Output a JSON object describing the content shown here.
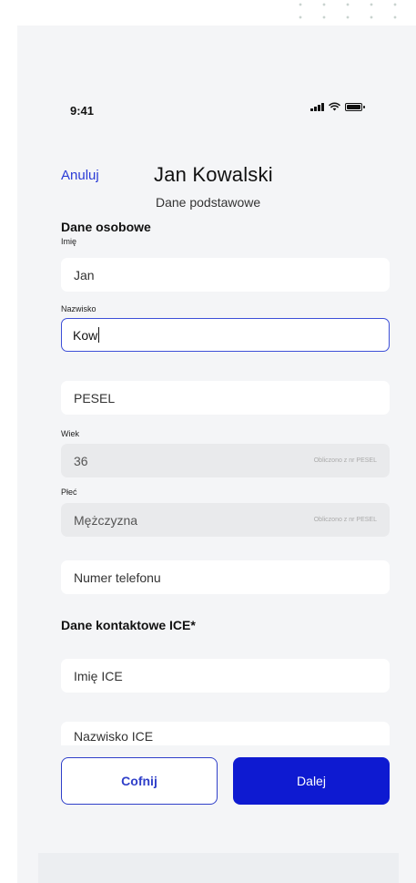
{
  "status": {
    "time": "9:41"
  },
  "header": {
    "cancel_label": "Anuluj",
    "title": "Jan Kowalski",
    "subtitle": "Dane podstawowe"
  },
  "sections": {
    "personal_title": "Dane osobowe",
    "ice_title": "Dane kontaktowe ICE*"
  },
  "fields": {
    "first_name": {
      "label": "Imię",
      "value": "Jan"
    },
    "last_name": {
      "label": "Nazwisko",
      "value": "Kow"
    },
    "pesel": {
      "placeholder": "PESEL"
    },
    "age": {
      "label": "Wiek",
      "value": "36",
      "hint": "Obliczono z nr PESEL"
    },
    "gender": {
      "label": "Płeć",
      "value": "Mężczyzna",
      "hint": "Obliczono z nr PESEL"
    },
    "phone": {
      "placeholder": "Numer telefonu"
    },
    "ice_first_name": {
      "placeholder": "Imię ICE"
    },
    "ice_last_name": {
      "placeholder": "Nazwisko ICE"
    }
  },
  "buttons": {
    "back_label": "Cofnij",
    "next_label": "Dalej"
  },
  "colors": {
    "accent": "#2a3bd6",
    "primary_button": "#0e1ad1",
    "background": "#f4f5f7",
    "field": "#ffffff",
    "field_readonly": "#e9eaec"
  }
}
